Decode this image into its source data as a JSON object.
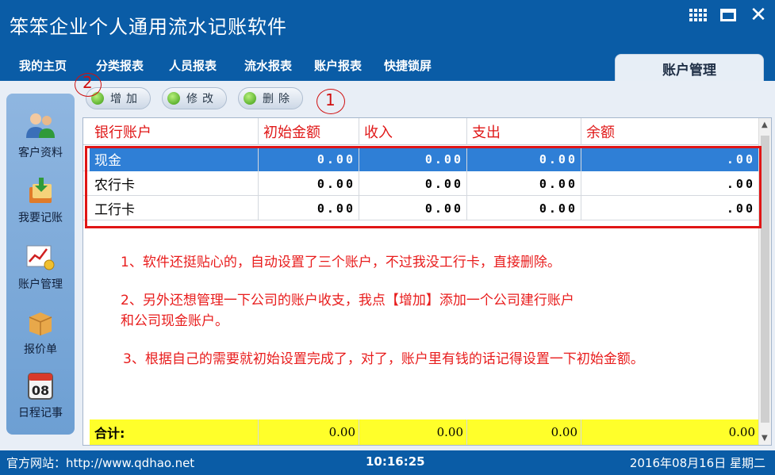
{
  "app": {
    "title": "笨笨企业个人通用流水记账软件"
  },
  "menu": {
    "items": [
      "我的主页",
      "分类报表",
      "人员报表",
      "流水报表",
      "账户报表",
      "快捷锁屏"
    ],
    "active_tab": "账户管理"
  },
  "sidebar": {
    "items": [
      {
        "label": "客户资料",
        "icon": "customers-icon"
      },
      {
        "label": "我要记账",
        "icon": "bookkeeping-icon"
      },
      {
        "label": "账户管理",
        "icon": "account-chart-icon"
      },
      {
        "label": "报价单",
        "icon": "quote-box-icon"
      },
      {
        "label": "日程记事",
        "icon": "calendar-icon"
      }
    ]
  },
  "calendar_day": "08",
  "toolbar": {
    "add_label": "增加",
    "edit_label": "修改",
    "delete_label": "删除"
  },
  "annotations": {
    "num1": "1",
    "num2": "2",
    "notes": [
      "1、软件还挺贴心的，自动设置了三个账户，不过我没工行卡，直接删除。",
      "2、另外还想管理一下公司的账户收支，我点【增加】添加一个公司建行账户",
      "和公司现金账户。",
      "3、根据自己的需要就初始设置完成了，对了，账户里有钱的话记得设置一下初始金额。"
    ]
  },
  "table": {
    "headers": [
      "银行账户",
      "初始金额",
      "收入",
      "支出",
      "余额"
    ],
    "rows": [
      {
        "name": "现金",
        "initial": "0.00",
        "income": "0.00",
        "expense": "0.00",
        "balance": ".00",
        "selected": true
      },
      {
        "name": "农行卡",
        "initial": "0.00",
        "income": "0.00",
        "expense": "0.00",
        "balance": ".00",
        "selected": false
      },
      {
        "name": "工行卡",
        "initial": "0.00",
        "income": "0.00",
        "expense": "0.00",
        "balance": ".00",
        "selected": false
      }
    ],
    "total": {
      "label": "合计:",
      "initial": "0.00",
      "income": "0.00",
      "expense": "0.00",
      "balance": "0.00"
    }
  },
  "status": {
    "website": "官方网站：http://www.qdhao.net",
    "time": "10:16:25",
    "date": "2016年08月16日  星期二"
  },
  "colors": {
    "titlebar": "#0a5ca6",
    "selected_row": "#2f7fd6",
    "header_text": "#e01818",
    "total_row": "#ffff2a",
    "annotation_red": "#e01515"
  }
}
